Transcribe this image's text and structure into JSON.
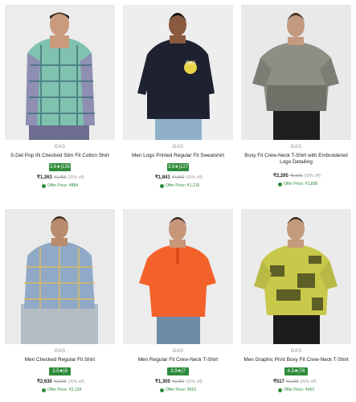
{
  "products": [
    {
      "brand": "GAS",
      "name": "S.Det Pop IN Checked Slim Fit Cotton Shirt",
      "rating": "3.6★|130",
      "price": "₹1,263",
      "was": "₹1,990",
      "off": "(35% off)",
      "offer": "Offer Price: ₹884"
    },
    {
      "brand": "GAS",
      "name": "Men Logo Printed Regular Fit Sweatshirt",
      "rating": "3.9★|127",
      "price": "₹1,841",
      "was": "₹4,590",
      "off": "(60% off)",
      "offer": "Offer Price: ₹1,215"
    },
    {
      "brand": "GAS",
      "name": "Boxy Fit Crew-Neck T-Shirt with Embroidered Logo Detailing",
      "rating": "",
      "price": "₹2,295",
      "was": "₹5,690",
      "off": "(60% off)",
      "offer": "Offer Price: ₹1,896"
    },
    {
      "brand": "GAS",
      "name": "Men Checked Regular Fit Shirt",
      "rating": "3.5★|8",
      "price": "₹2,630",
      "was": "₹3,990",
      "off": "(35% off)",
      "offer": "Offer Price: ₹2,104"
    },
    {
      "brand": "GAS",
      "name": "Men Regular Fit Crew-Neck T-Shirt",
      "rating": "3.9★|7",
      "price": "₹1,300",
      "was": "₹3,250",
      "off": "(60% off)",
      "offer": "Offer Price: ₹910"
    },
    {
      "brand": "GAS",
      "name": "Men Graphic Print Boxy Fit Crew-Neck T-Shirt",
      "rating": "4.3★|76",
      "price": "₹517",
      "was": "₹1,290",
      "off": "(60% off)",
      "offer": "Offer Price: ₹462"
    }
  ],
  "colors": {
    "rating_bg": "#2e8b3a",
    "offer_text": "#2e8b3a",
    "image_bg": "#ebebeb"
  },
  "icons": {
    "offer": "green-dot-icon"
  }
}
